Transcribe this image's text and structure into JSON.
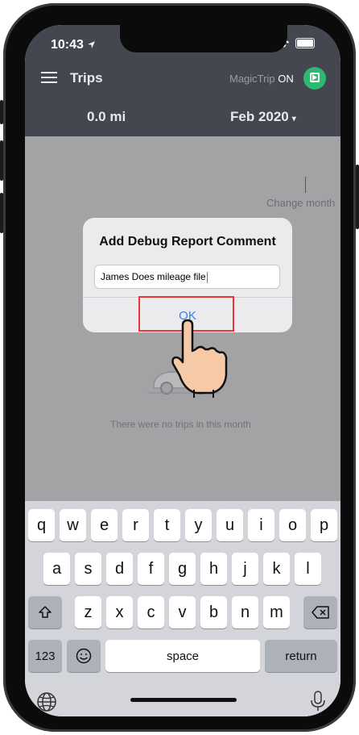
{
  "status": {
    "time": "10:43"
  },
  "header": {
    "title": "Trips",
    "magictrip_label": "MagicTrip",
    "magictrip_state": "ON",
    "miles": "0.0 mi",
    "month": "Feb 2020",
    "month_caret": "▾"
  },
  "body": {
    "change_month": "Change month",
    "empty_message": "There were no trips in this month"
  },
  "dialog": {
    "title": "Add Debug Report Comment",
    "input_value": "James Does mileage file",
    "ok_label": "OK"
  },
  "keyboard": {
    "row1": [
      "q",
      "w",
      "e",
      "r",
      "t",
      "y",
      "u",
      "i",
      "o",
      "p"
    ],
    "row2": [
      "a",
      "s",
      "d",
      "f",
      "g",
      "h",
      "j",
      "k",
      "l"
    ],
    "row3": [
      "z",
      "x",
      "c",
      "v",
      "b",
      "n",
      "m"
    ],
    "numbers_label": "123",
    "space_label": "space",
    "return_label": "return",
    "icons": [
      "shift-icon",
      "backspace-icon",
      "emoji-icon",
      "globe-icon",
      "microphone-icon"
    ]
  },
  "colors": {
    "header": "#44474f",
    "accent": "#2f80ff",
    "magictrip": "#2eb872",
    "highlight": "#e33"
  }
}
